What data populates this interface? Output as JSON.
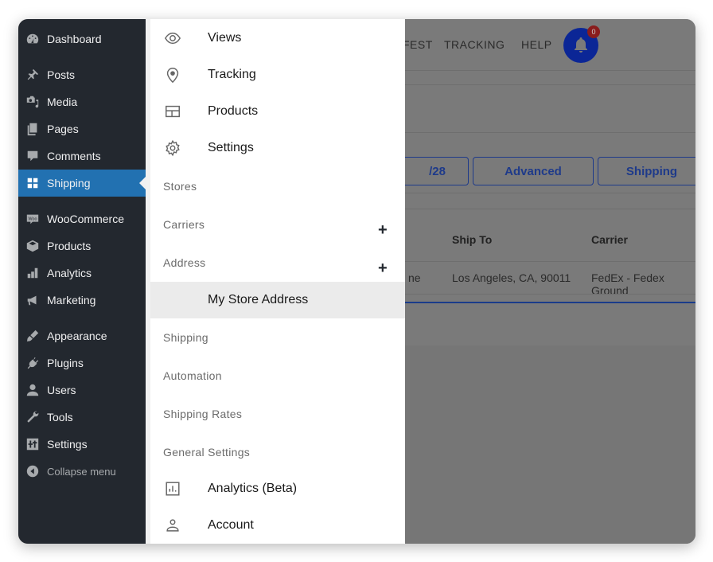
{
  "wp_sidebar": {
    "items": [
      {
        "label": "Dashboard",
        "icon": "dashboard-icon"
      },
      {
        "label": "Posts",
        "icon": "pin-icon"
      },
      {
        "label": "Media",
        "icon": "media-icon"
      },
      {
        "label": "Pages",
        "icon": "pages-icon"
      },
      {
        "label": "Comments",
        "icon": "comment-icon"
      },
      {
        "label": "Shipping",
        "icon": "grid-icon",
        "active": true
      },
      {
        "label": "WooCommerce",
        "icon": "woo-icon"
      },
      {
        "label": "Products",
        "icon": "box-icon"
      },
      {
        "label": "Analytics",
        "icon": "bar-chart-icon"
      },
      {
        "label": "Marketing",
        "icon": "megaphone-icon"
      },
      {
        "label": "Appearance",
        "icon": "brush-icon"
      },
      {
        "label": "Plugins",
        "icon": "plug-icon"
      },
      {
        "label": "Users",
        "icon": "user-icon"
      },
      {
        "label": "Tools",
        "icon": "wrench-icon"
      },
      {
        "label": "Settings",
        "icon": "sliders-icon"
      },
      {
        "label": "Collapse menu",
        "icon": "collapse-icon"
      }
    ],
    "active_color": "#2271b1"
  },
  "flyout": {
    "items": [
      {
        "label": "Views",
        "type": "item",
        "icon": "eye-icon"
      },
      {
        "label": "Tracking",
        "type": "item",
        "icon": "location-pin-icon"
      },
      {
        "label": "Products",
        "type": "item",
        "icon": "layout-icon"
      },
      {
        "label": "Settings",
        "type": "item",
        "icon": "gear-icon"
      },
      {
        "label": "Stores",
        "type": "section"
      },
      {
        "label": "Carriers",
        "type": "section",
        "expandable": true
      },
      {
        "label": "Address",
        "type": "section",
        "expandable": true
      },
      {
        "label": "My Store Address",
        "type": "subitem",
        "selected": true
      },
      {
        "label": "Shipping",
        "type": "section"
      },
      {
        "label": "Automation",
        "type": "section"
      },
      {
        "label": "Shipping Rates",
        "type": "section"
      },
      {
        "label": "General Settings",
        "type": "section"
      },
      {
        "label": "Analytics (Beta)",
        "type": "item",
        "icon": "analytics-icon"
      },
      {
        "label": "Account",
        "type": "item",
        "icon": "account-icon"
      }
    ],
    "plus_symbol": "+"
  },
  "background": {
    "top_nav": [
      "FEST",
      "TRACKING",
      "HELP"
    ],
    "notification_count": "0",
    "buttons": [
      "/28",
      "Advanced",
      "Shipping"
    ],
    "table": {
      "headers": [
        "Ship To",
        "Carrier"
      ],
      "row": {
        "partial": "ne",
        "ship_to": "Los Angeles, CA, 90011",
        "carrier": "FedEx - Fedex Ground"
      }
    },
    "bell_color": "#0b2696",
    "accent_color": "#1e3a8a"
  }
}
